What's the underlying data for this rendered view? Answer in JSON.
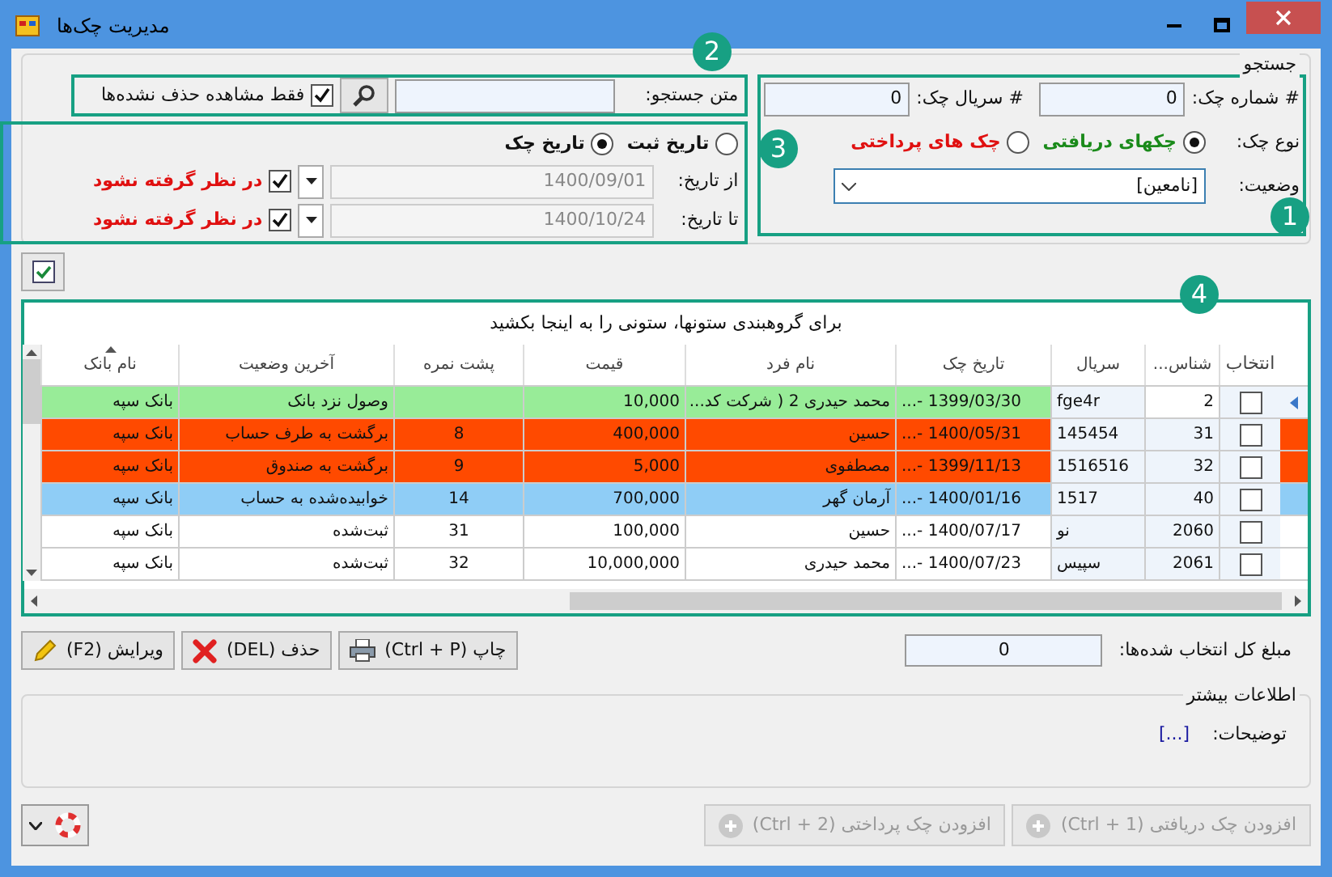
{
  "window": {
    "title": "مدیریت چک‌ها"
  },
  "callouts": [
    {
      "label": "1"
    },
    {
      "label": "2"
    },
    {
      "label": "3"
    },
    {
      "label": "4"
    }
  ],
  "search": {
    "title": "جستجو",
    "check_number": {
      "label": "# شماره چک:",
      "value": "0"
    },
    "serial": {
      "label": "# سریال  چک:",
      "value": "0"
    },
    "check_type": {
      "label": "نوع چک:",
      "options": [
        {
          "label": "چکهای دریافتی",
          "selected": true,
          "color": "#1a8a1a"
        },
        {
          "label": "چک های پرداختی",
          "selected": false,
          "color": "#e01010"
        }
      ]
    },
    "status": {
      "label": "وضعیت:",
      "value": "[نامعین]"
    },
    "search_text": {
      "label": "متن جستجو:"
    },
    "only_undeleted": {
      "label": "فقط مشاهده حذف نشده‌ها",
      "checked": true
    },
    "date_type": [
      {
        "label": "تاریخ ثبت",
        "selected": false
      },
      {
        "label": "تاریخ چک",
        "selected": true
      }
    ],
    "dates": [
      {
        "label": "از تاریخ:",
        "value": "1400/09/01",
        "disabled": true,
        "exclude_label": "در نظر گرفته نشود",
        "exclude_checked": true
      },
      {
        "label": "تا تاریخ:",
        "value": "1400/10/24",
        "disabled": true,
        "exclude_label": "در نظر گرفته نشود",
        "exclude_checked": true
      }
    ]
  },
  "grid": {
    "group_hint": "برای گروهبندی ستونها، ستونی را به اینجا بکشید",
    "select_column": {
      "label": "انتخاب"
    },
    "columns": [
      {
        "label": "شناس...",
        "sorted": false
      },
      {
        "label": "سریال",
        "sorted": false
      },
      {
        "label": "تاریخ چک",
        "sorted": false
      },
      {
        "label": "نام فرد",
        "sorted": false
      },
      {
        "label": "قیمت",
        "sorted": false
      },
      {
        "label": "پشت نمره",
        "sorted": false
      },
      {
        "label": "آخرین وضعیت",
        "sorted": false
      },
      {
        "label": "نام بانک",
        "sorted": true
      }
    ],
    "rows": [
      {
        "current": true,
        "checked": false,
        "color": "#98ec98",
        "cells": [
          "2",
          "fge4r",
          "1399/03/30 -...",
          "محمد حیدری 2 ( شرکت کد...",
          "10,000",
          "",
          "وصول نزد بانک",
          "بانک سپه"
        ]
      },
      {
        "current": false,
        "checked": false,
        "color": "#ff4a00",
        "cells": [
          "31",
          "145454",
          "1400/05/31 -...",
          "حسین",
          "400,000",
          "8",
          "برگشت به طرف حساب",
          "بانک سپه"
        ]
      },
      {
        "current": false,
        "checked": false,
        "color": "#ff4a00",
        "cells": [
          "32",
          "1516516",
          "1399/11/13 -...",
          "مصطفوی",
          "5,000",
          "9",
          "برگشت به صندوق",
          "بانک سپه"
        ]
      },
      {
        "current": false,
        "checked": false,
        "color": "#8fcdf6",
        "cells": [
          "40",
          "1517",
          "1400/01/16 -...",
          "آرمان گهر",
          "700,000",
          "14",
          "خوابیده‌شده به حساب",
          "بانک سپه"
        ]
      },
      {
        "current": false,
        "checked": false,
        "color": "#ffffff",
        "cells": [
          "2060",
          "نو",
          "1400/07/17 -...",
          "حسین",
          "100,000",
          "31",
          "ثبت‌شده",
          "بانک سپه"
        ]
      },
      {
        "current": false,
        "checked": false,
        "color": "#ffffff",
        "cells": [
          "2061",
          "سپیس",
          "1400/07/23 -...",
          "محمد حیدری",
          "10,000,000",
          "32",
          "ثبت‌شده",
          "بانک سپه"
        ]
      }
    ]
  },
  "summary": {
    "label": "مبلغ کل انتخاب شده‌ها:",
    "value": "0"
  },
  "actions": [
    {
      "kind": "print",
      "label": "چاپ (Ctrl + P)"
    },
    {
      "kind": "delete",
      "label": "حذف (DEL)"
    },
    {
      "kind": "edit",
      "label": "ویرایش (F2)"
    }
  ],
  "more_info": {
    "title": "اطلاعات بیشتر",
    "description_label": "توضیحات:",
    "description_value": "[...]"
  },
  "add_buttons": [
    {
      "label": "افزودن چک دریافتی (Ctrl + 1)",
      "disabled": true
    },
    {
      "label": "افزودن چک پرداختی (Ctrl + 2)",
      "disabled": true
    }
  ]
}
